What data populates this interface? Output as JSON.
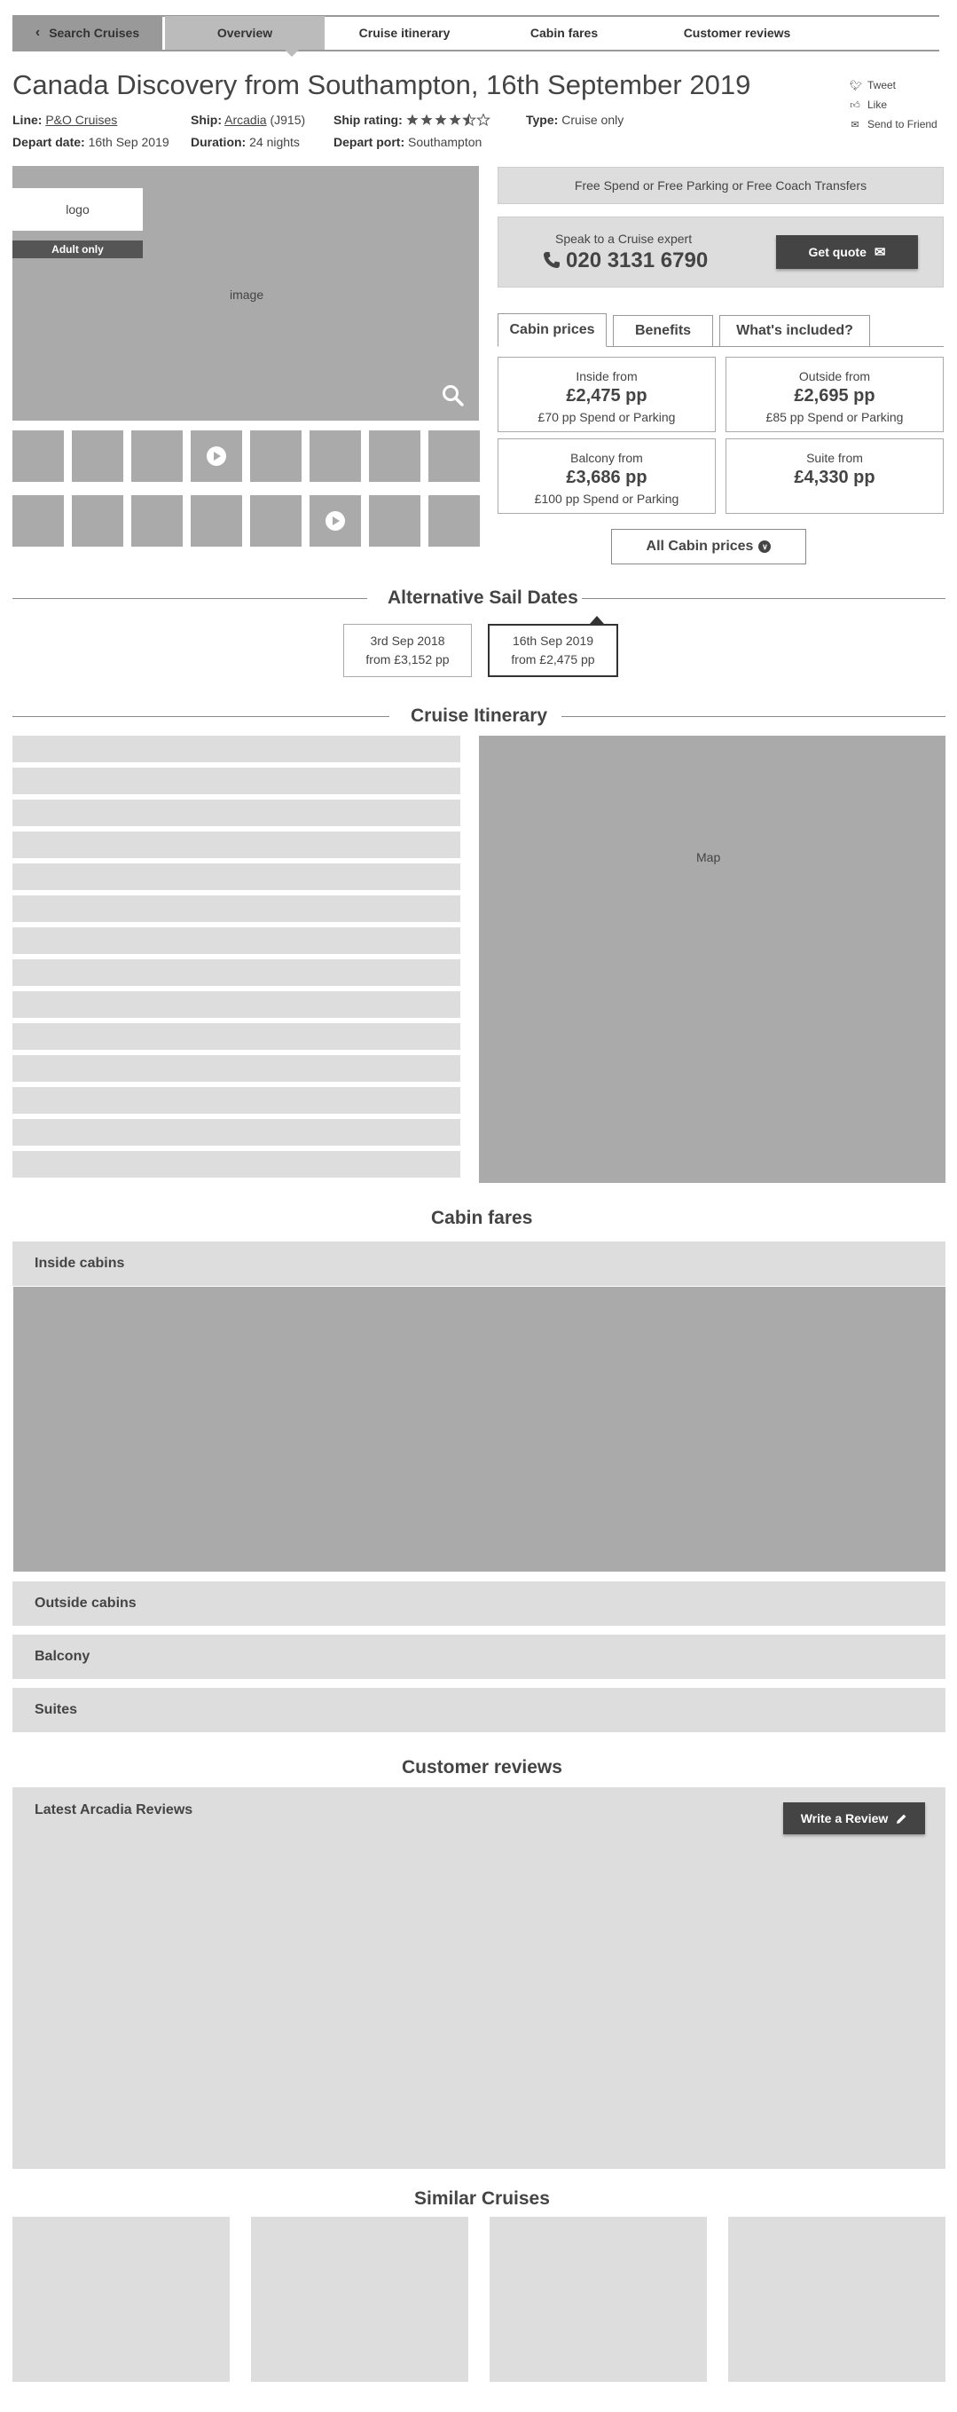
{
  "nav": {
    "back_label": "Search Cruises",
    "tabs": [
      {
        "label": "Overview",
        "active": true
      },
      {
        "label": "Cruise itinerary",
        "active": false
      },
      {
        "label": "Cabin fares",
        "active": false
      },
      {
        "label": "Customer reviews",
        "active": false
      }
    ]
  },
  "cruise": {
    "title": "Canada Discovery from Southampton, 16th September 2019",
    "line_label": "Line:",
    "line_value": "P&O Cruises",
    "ship_label": "Ship:",
    "ship_value": "Arcadia",
    "ship_code": "(J915)",
    "rating_label": "Ship rating:",
    "rating_stars": 4.5,
    "rating_max": 5,
    "type_label": "Type:",
    "type_value": "Cruise only",
    "depart_date_label": "Depart date:",
    "depart_date_value": "16th Sep 2019",
    "duration_label": "Duration:",
    "duration_value": "24 nights",
    "depart_port_label": "Depart port:",
    "depart_port_value": "Southampton"
  },
  "share": {
    "tweet": "Tweet",
    "like": "Like",
    "send": "Send to Friend"
  },
  "gallery": {
    "logo_label": "logo",
    "badge": "Adult only",
    "image_label": "image"
  },
  "offer": {
    "text": "Free Spend or Free Parking or Free Coach Transfers"
  },
  "expert": {
    "label": "Speak to a Cruise expert",
    "phone": "020 3131 6790",
    "quote_button": "Get quote"
  },
  "cabin_tabs": [
    "Cabin prices",
    "Benefits",
    "What's included?"
  ],
  "prices": [
    {
      "label": "Inside from",
      "price": "£2,475 pp",
      "sub": "£70 pp Spend or Parking"
    },
    {
      "label": "Outside from",
      "price": "£2,695 pp",
      "sub": "£85 pp Spend or Parking"
    },
    {
      "label": "Balcony from",
      "price": "£3,686 pp",
      "sub": "£100 pp Spend or Parking"
    },
    {
      "label": "Suite from",
      "price": "£4,330 pp",
      "sub": ""
    }
  ],
  "all_cabins_button": "All Cabin prices",
  "sail_dates": {
    "title": "Alternative Sail Dates",
    "items": [
      {
        "date": "3rd Sep 2018",
        "price": "from £3,152 pp",
        "selected": false
      },
      {
        "date": "16th Sep 2019",
        "price": "from £2,475 pp",
        "selected": true
      }
    ]
  },
  "itinerary": {
    "title": "Cruise Itinerary",
    "map_label": "Map"
  },
  "cabin_fares": {
    "title": "Cabin fares",
    "sections": [
      "Inside cabins",
      "Outside cabins",
      "Balcony",
      "Suites"
    ]
  },
  "reviews": {
    "title": "Customer reviews",
    "panel_title": "Latest Arcadia Reviews",
    "write_button": "Write a Review"
  },
  "similar": {
    "title": "Similar Cruises"
  }
}
